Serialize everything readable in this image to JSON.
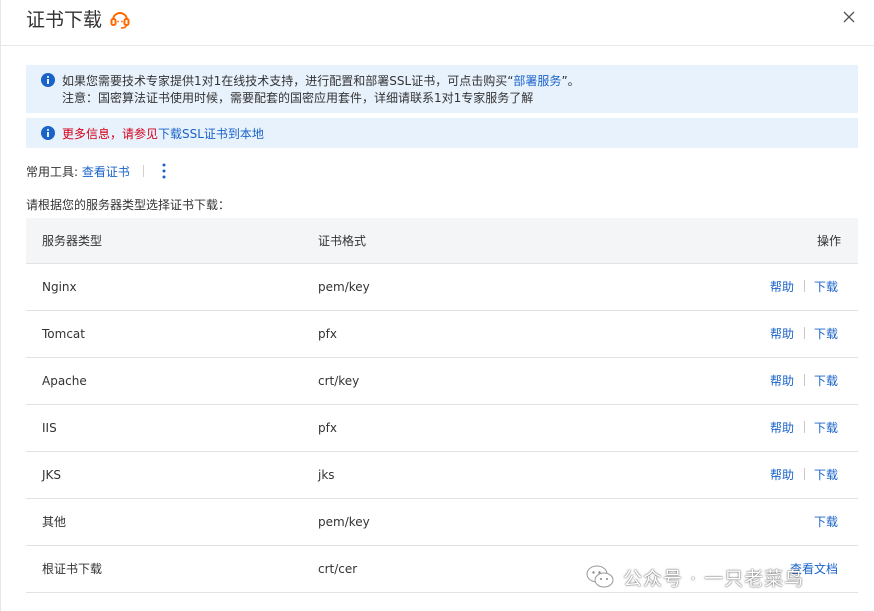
{
  "dialog": {
    "title": "证书下载"
  },
  "alerts": {
    "line1_prefix": "如果您需要技术专家提供1对1在线技术支持，进行配置和部署SSL证书，可点击购买“",
    "line1_link": "部署服务",
    "line1_suffix": "”。",
    "line2": "注意：国密算法证书使用时候，需要配套的国密应用套件，详细请联系1对1专家服务了解",
    "more_prefix": "更多信息，请参见",
    "more_link": "下载SSL证书到本地"
  },
  "tools": {
    "label": "常用工具:",
    "view_cert": "查看证书"
  },
  "prompt": "请根据您的服务器类型选择证书下载：",
  "table": {
    "headers": {
      "server": "服务器类型",
      "format": "证书格式",
      "action": "操作"
    },
    "rows": [
      {
        "server": "Nginx",
        "format": "pem/key",
        "help": "帮助",
        "download": "下载"
      },
      {
        "server": "Tomcat",
        "format": "pfx",
        "help": "帮助",
        "download": "下载"
      },
      {
        "server": "Apache",
        "format": "crt/key",
        "help": "帮助",
        "download": "下载"
      },
      {
        "server": "IIS",
        "format": "pfx",
        "help": "帮助",
        "download": "下载"
      },
      {
        "server": "JKS",
        "format": "jks",
        "help": "帮助",
        "download": "下载"
      },
      {
        "server": "其他",
        "format": "pem/key",
        "download": "下载"
      },
      {
        "server": "根证书下载",
        "format": "crt/cer",
        "doc": "查看文档"
      }
    ]
  },
  "watermark": "公众号 · 一只老菜鸟",
  "icons": {
    "support": "headset-icon",
    "close": "close-icon",
    "info": "info-icon",
    "more": "more-vertical-icon",
    "wechat": "wechat-icon"
  },
  "colors": {
    "accent": "#1a63c9",
    "alert_bg": "#e8f2fd",
    "warning_red": "#d4001a",
    "support_orange": "#ff6a00"
  }
}
